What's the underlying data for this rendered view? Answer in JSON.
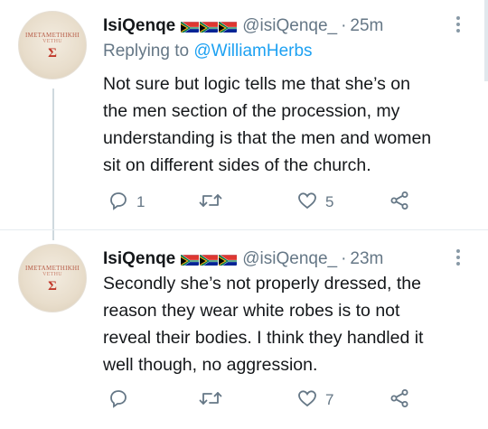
{
  "tweets": [
    {
      "display_name": "IsiQenqe",
      "handle": "@isiQenqe_",
      "time": "25m",
      "replying_prefix": "Replying to",
      "replying_to": "@WilliamHerbs",
      "body_lines": [
        "Not sure but logic tells me that she’s on",
        "the men section of the procession, my",
        "understanding is that the men and women",
        "sit on different sides of the church."
      ],
      "reply_count": "1",
      "retweet_count": "",
      "like_count": "5",
      "avatar": {
        "line1": "IMETAMETHIKHI",
        "line2": "VETHU",
        "symbol": "Σ"
      }
    },
    {
      "display_name": "IsiQenqe",
      "handle": "@isiQenqe_",
      "time": "23m",
      "body_lines": [
        "Secondly she’s not properly dressed, the",
        "reason they wear white robes is to not",
        "reveal their bodies. I think they handled it",
        "well though, no aggression."
      ],
      "reply_count": "",
      "retweet_count": "",
      "like_count": "7",
      "avatar": {
        "line1": "IMETAMETHIKHI",
        "line2": "VETHU",
        "symbol": "Σ"
      }
    }
  ],
  "separator": "·",
  "icons": {
    "flag": "south-africa-flag-icon",
    "reply": "reply-icon",
    "retweet": "retweet-icon",
    "like": "heart-icon",
    "share": "share-icon",
    "more": "more-vertical-icon"
  },
  "colors": {
    "text": "#14171a",
    "muted": "#657786",
    "link": "#1da1f2",
    "thread_line": "#cfd9de"
  }
}
